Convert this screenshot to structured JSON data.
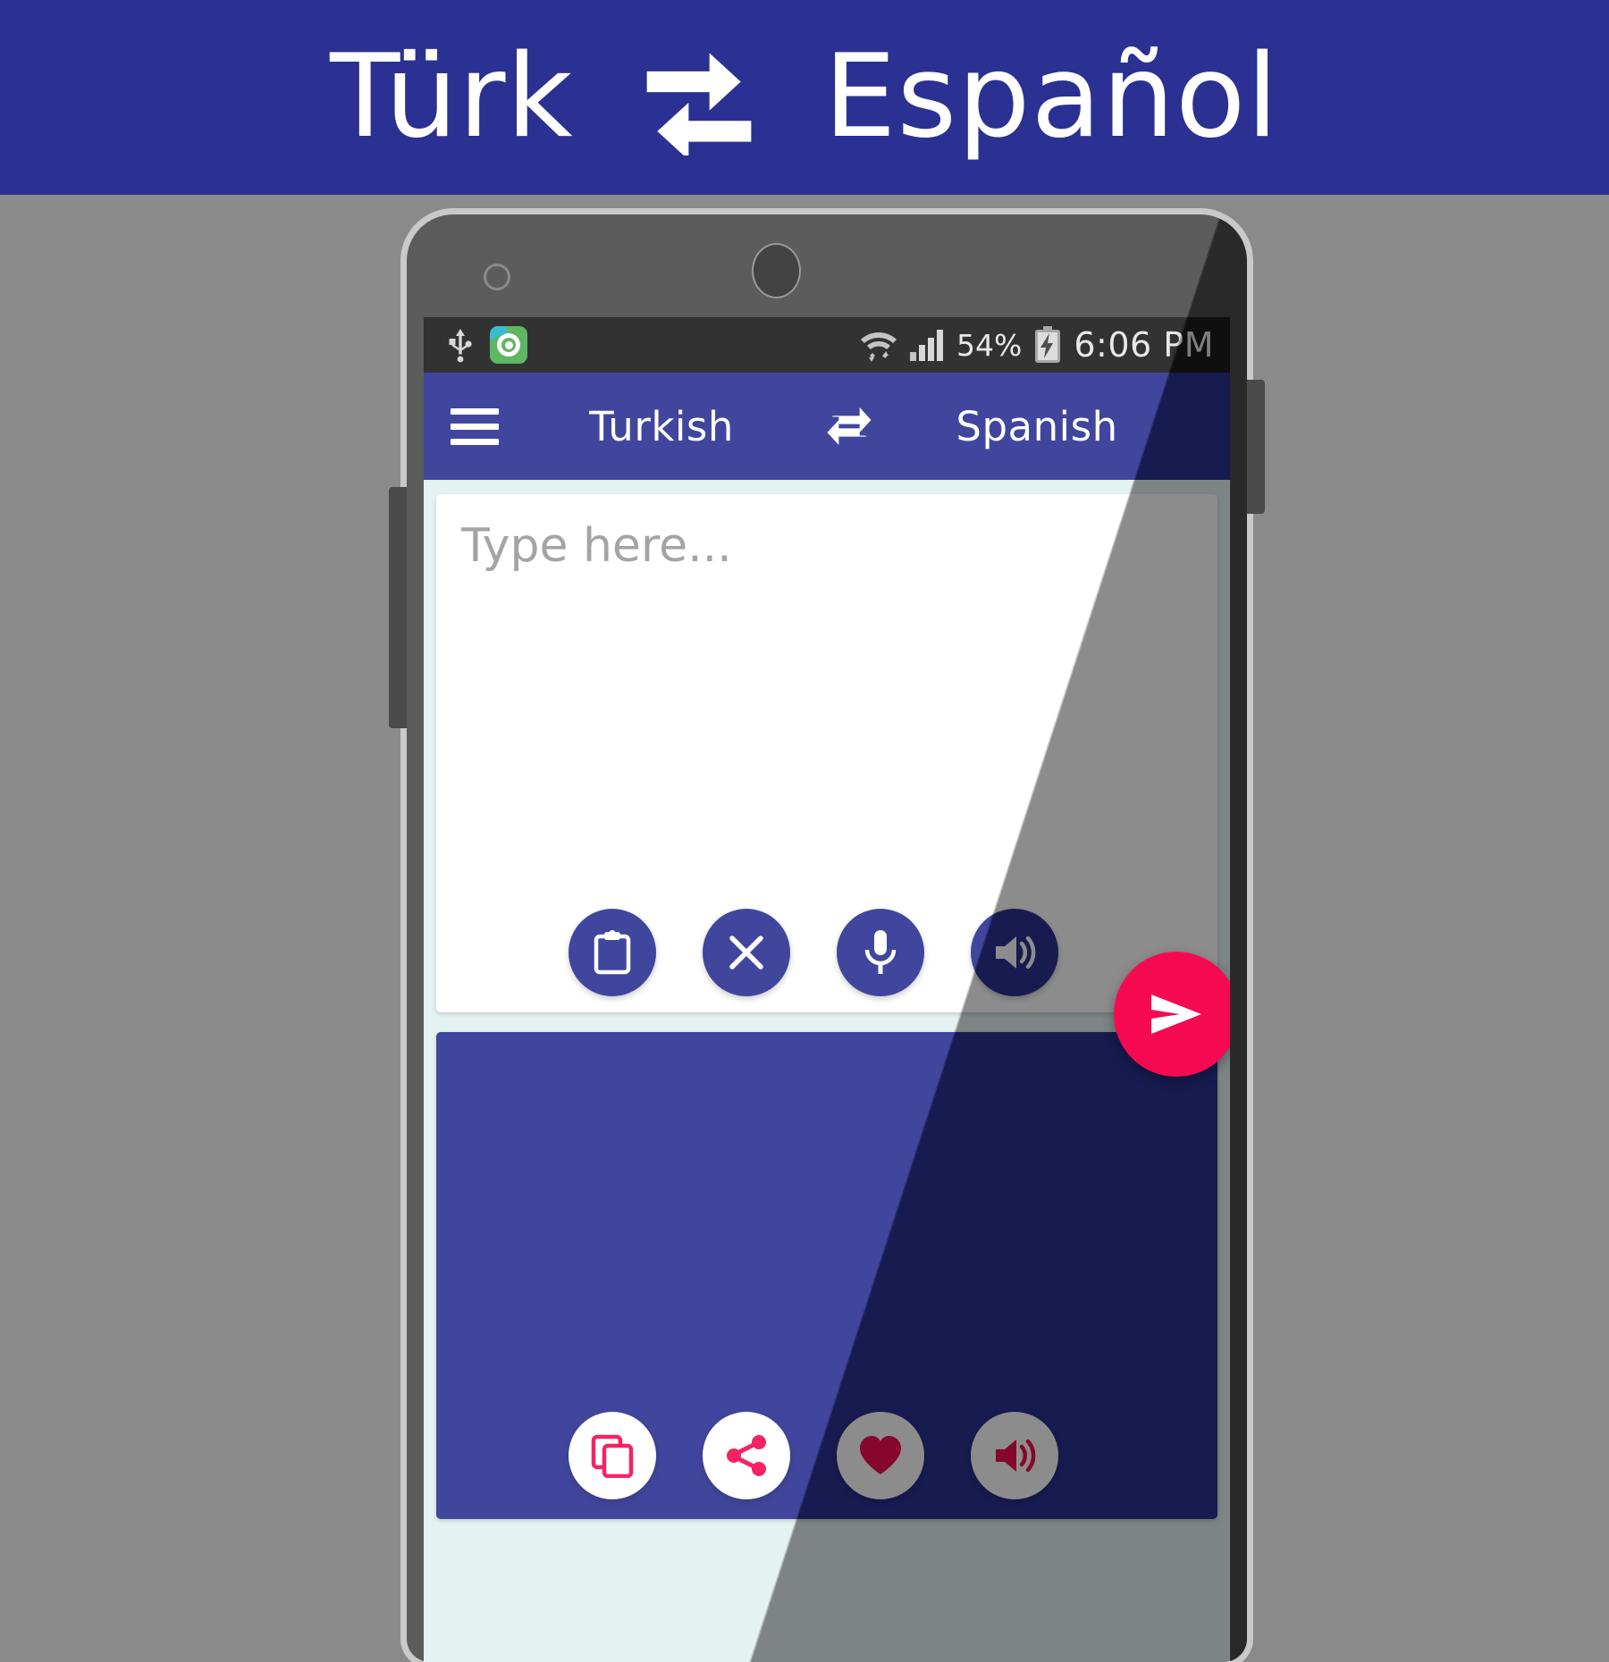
{
  "banner": {
    "source_label": "Türk",
    "target_label": "Español",
    "swap_icon": "swap-arrows-icon",
    "background_color": "#2b3192",
    "text_color": "#ffffff"
  },
  "phone": {
    "frame_color": "#4a4a4a",
    "bezel_color": "#c9c9c9",
    "camera_icon": "front-camera-icon",
    "sensor_icon": "proximity-sensor-icon",
    "volume_button": "volume-rocker",
    "power_button": "power-button"
  },
  "status_bar": {
    "usb_icon": "usb-icon",
    "app_icon": "recorder-app-icon",
    "wifi_icon": "wifi-icon",
    "signal_icon": "cellular-signal-icon",
    "battery_percent": "54%",
    "battery_icon": "battery-charging-icon",
    "time": "6:06 PM",
    "background_color": "#1b1b1b"
  },
  "toolbar": {
    "menu_icon": "hamburger-menu-icon",
    "source_language": "Turkish",
    "swap_icon": "swap-languages-icon",
    "target_language": "Spanish",
    "background_color": "#2b3192"
  },
  "input_card": {
    "placeholder": "Type here...",
    "value": "",
    "background_color": "#ffffff",
    "actions": [
      {
        "name": "paste-button",
        "icon": "clipboard-icon",
        "label": "Paste"
      },
      {
        "name": "clear-button",
        "icon": "close-icon",
        "label": "Clear"
      },
      {
        "name": "voice-input-button",
        "icon": "microphone-icon",
        "label": "Speak"
      },
      {
        "name": "speak-source-button",
        "icon": "speaker-icon",
        "label": "Listen"
      }
    ]
  },
  "send_button": {
    "name": "translate-send-button",
    "icon": "send-icon",
    "label": "Translate",
    "color": "#f50a52"
  },
  "output_card": {
    "text": "",
    "background_color": "#2b3192",
    "actions": [
      {
        "name": "copy-button",
        "icon": "copy-icon",
        "label": "Copy"
      },
      {
        "name": "share-button",
        "icon": "share-icon",
        "label": "Share"
      },
      {
        "name": "favorite-button",
        "icon": "heart-icon",
        "label": "Favorite"
      },
      {
        "name": "speak-result-button",
        "icon": "speaker-icon",
        "label": "Listen"
      }
    ]
  },
  "colors": {
    "primary_blue": "#2b3192",
    "accent_pink": "#f50a52",
    "screen_background": "#e2f1f0",
    "page_background": "#8a8a8a"
  }
}
